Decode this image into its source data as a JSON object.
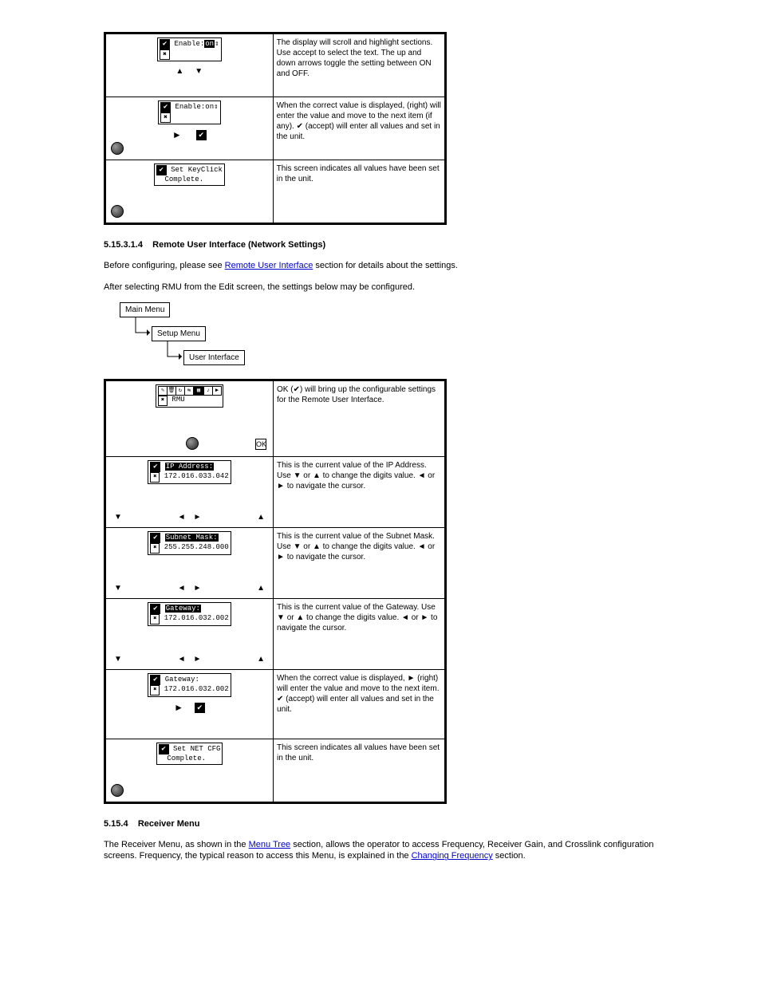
{
  "table1": {
    "rows": [
      {
        "lcd_lines": [
          "Enable:",
          "on"
        ],
        "invert_last": true,
        "arrow_icons": "up-down",
        "right_text": "The display will scroll and highlight\nsections. Use accept to select the\ntext. The up and down arrows\ntoggle the setting between ON and\nOFF."
      },
      {
        "lcd_lines": [
          "Enable:on"
        ],
        "arrow_icons": "right-check-knob",
        "right_text": "When the correct value is displayed,\n  (right) will enter the value and\nmove to the next item (if any). ✔\n(accept) will enter all values and\nset in the unit."
      },
      {
        "lcd_lines": [
          "Set KeyClick",
          "Complete."
        ],
        "arrow_icons": "knob-left",
        "right_text": "This screen indicates all values\nhave been set in the unit."
      }
    ]
  },
  "section_net": {
    "heading_num": "5.15.3.1.4",
    "heading_text": "Remote User Interface (Network Settings)",
    "para": "Before configuring, please see ",
    "xref": "Remote User Interface",
    "para_tail": " section for details about the settings.",
    "para2": "After selecting RMU from the Edit screen, the settings below may be configured."
  },
  "breadcrumb": {
    "b1": "Main Menu",
    "b2": "Setup Menu",
    "b3": "User Interface"
  },
  "table2": {
    "rows": [
      {
        "type": "iconrow",
        "label": "RMU",
        "right_text": "OK (✔) will bring up the\nconfigurable settings for the\nRemote User Interface."
      },
      {
        "type": "ip",
        "label": "IP Address:",
        "value": "172.016.033.042",
        "right_text": "This is the current value of the IP\nAddress. Use ▼ or ▲ to change the\ndigits value. ◄ or ► to navigate\nthe cursor."
      },
      {
        "type": "ip",
        "label": "Subnet Mask:",
        "value": "255.255.248.000",
        "right_text": "This is the current value of the\nSubnet Mask. Use ▼ or ▲ to\nchange the digits value. ◄ or ► to\nnavigate the cursor."
      },
      {
        "type": "ip",
        "label": "Gateway:",
        "value": "172.016.032.002",
        "right_text": "This is the current value of the\nGateway. Use ▼ or ▲ to change\nthe digits value. ◄ or ► to\nnavigate the cursor."
      },
      {
        "type": "ip-final",
        "label": "Gateway:",
        "value": "172.016.032.002",
        "right_text": "When the correct value is displayed,\n► (right) will enter the value and\nmove to the next item. ✔ (accept)\nwill enter all values and set in the\nunit."
      },
      {
        "type": "complete",
        "label": "Set NET CFG",
        "value": "Complete.",
        "right_text": "This screen indicates all values\nhave been set in the unit."
      }
    ]
  },
  "section_rx": {
    "heading_num": "5.15.4",
    "heading_text": "Receiver Menu",
    "para_pre": "The Receiver Menu, as shown in the ",
    "xref": "Menu Tree",
    "para_mid": " section, allows the operator to access Frequency, Receiver Gain, and Crosslink configuration screens. Frequency, the typical reason to access this Menu, is explained in the ",
    "xref2": "Changing Frequency",
    "para_tail": " section."
  }
}
